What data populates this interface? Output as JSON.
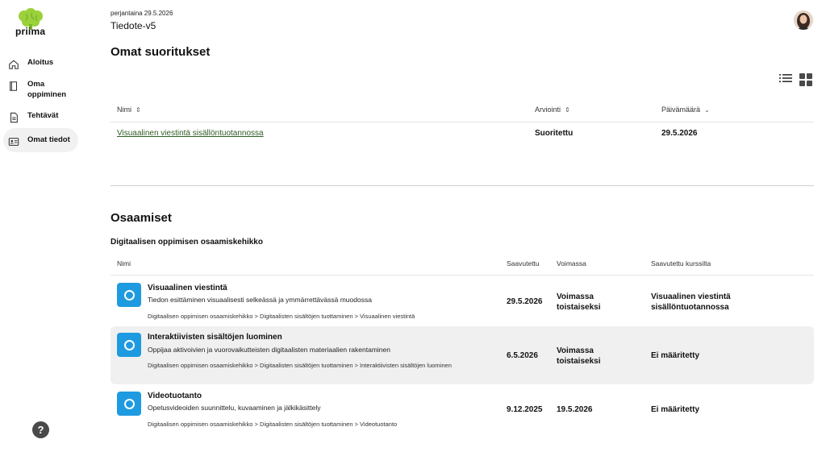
{
  "brand": {
    "name": "priima"
  },
  "sidebar": {
    "items": [
      {
        "label": "Aloitus",
        "icon": "home-icon"
      },
      {
        "label": "Oma oppiminen",
        "icon": "book-icon"
      },
      {
        "label": "Tehtävät",
        "icon": "document-icon"
      },
      {
        "label": "Omat tiedot",
        "icon": "id-card-icon",
        "active": true
      }
    ],
    "help_label": "?"
  },
  "header": {
    "date": "perjantaina 29.5.2026",
    "title": "Tiedote-v5"
  },
  "achievements": {
    "title": "Omat suoritukset",
    "columns": {
      "name": "Nimi",
      "grade": "Arviointi",
      "date": "Päivämäärä"
    },
    "rows": [
      {
        "name": "Visuaalinen viestintä sisällöntuotannossa",
        "grade": "Suoritettu",
        "date": "29.5.2026"
      }
    ]
  },
  "competences": {
    "title": "Osaamiset",
    "framework": "Digitaalisen oppimisen osaamiskehikko",
    "columns": {
      "name": "Nimi",
      "achieved": "Saavutettu",
      "valid": "Voimassa",
      "from_course": "Saavutettu kurssilta"
    },
    "rows": [
      {
        "title": "Visuaalinen viestintä",
        "description": "Tiedon esittäminen visuaalisesti selkeässä ja ymmärrettävässä muodossa",
        "path": "Digitaalisen oppimisen osaamiskehikko > Digitaalisten sisältöjen tuottaminen > Visuaalinen viestintä",
        "achieved": "29.5.2026",
        "valid": "Voimassa toistaiseksi",
        "from_course": "Visuaalinen viestintä sisällöntuotannossa"
      },
      {
        "title": "Interaktiivisten sisältöjen luominen",
        "description": "Oppijaa aktivoivien ja vuorovaikutteisten digitaalisten materiaalien rakentaminen",
        "path": "Digitaalisen oppimisen osaamiskehikko > Digitaalisten sisältöjen tuottaminen > Interaktiivisten sisältöjen luominen",
        "achieved": "6.5.2026",
        "valid": "Voimassa toistaiseksi",
        "from_course": "Ei määritetty"
      },
      {
        "title": "Videotuotanto",
        "description": "Opetusvideoiden suunnittelu, kuvaaminen ja jälkikäsittely",
        "path": "Digitaalisen oppimisen osaamiskehikko > Digitaalisten sisältöjen tuottaminen > Videotuotanto",
        "achieved": "9.12.2025",
        "valid": "19.5.2026",
        "from_course": "Ei määritetty"
      }
    ]
  },
  "colors": {
    "accent_icon": "#1e9be0",
    "link": "#2f5d24",
    "brand_green": "#9bd13a"
  }
}
